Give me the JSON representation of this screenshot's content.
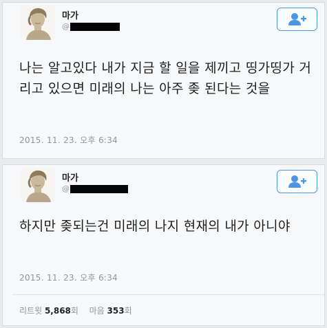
{
  "tweet1": {
    "name": "마가",
    "handle_prefix": "@",
    "text": "나는 알고있다 내가 지금 할 일을 제끼고 띵가띵가 거리고 있으면 미래의 나는 아주 좆 된다는 것을",
    "time": "2015. 11. 23. 오후 6:34",
    "follow_icon": "add-user-icon"
  },
  "tweet2": {
    "name": "마가",
    "handle_prefix": "@",
    "text": "하지만 좆되는건 미래의 나지 현재의 내가 아니야",
    "time": "2015. 11. 23. 오후 6:34",
    "follow_icon": "add-user-icon",
    "retweet_label": "리트윗",
    "retweet_count": "5,868",
    "retweet_unit": "회",
    "like_label": "마음",
    "like_count": "353",
    "like_unit": "회"
  },
  "colors": {
    "accent": "#4b97e1",
    "meta": "#8899a6"
  }
}
